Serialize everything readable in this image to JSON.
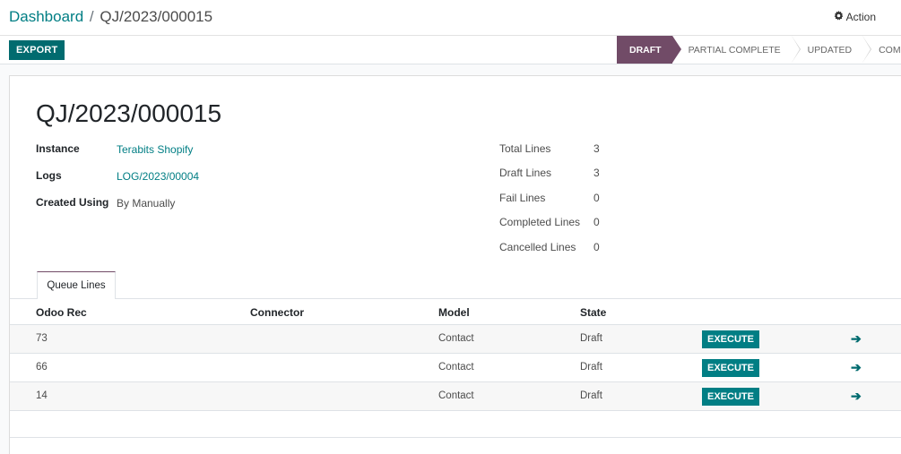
{
  "breadcrumb": {
    "parent": "Dashboard",
    "separator": "/",
    "current": "QJ/2023/000015"
  },
  "action": {
    "icon": "gear-icon",
    "label": "Action"
  },
  "toolbar": {
    "export_label": "EXPORT"
  },
  "statusbar": {
    "stages": [
      {
        "label": "DRAFT",
        "active": true
      },
      {
        "label": "PARTIAL COMPLETE",
        "active": false
      },
      {
        "label": "UPDATED",
        "active": false
      },
      {
        "label": "COMPLETE",
        "active": false
      }
    ]
  },
  "record": {
    "title": "QJ/2023/000015",
    "fields": {
      "instance": {
        "label": "Instance",
        "value": "Terabits Shopify"
      },
      "logs": {
        "label": "Logs",
        "value": "LOG/2023/00004"
      },
      "created_using": {
        "label": "Created Using",
        "value": "By Manually"
      }
    },
    "stats": [
      {
        "label": "Total Lines",
        "value": "3"
      },
      {
        "label": "Draft Lines",
        "value": "3"
      },
      {
        "label": "Fail Lines",
        "value": "0"
      },
      {
        "label": "Completed Lines",
        "value": "0"
      },
      {
        "label": "Cancelled Lines",
        "value": "0"
      }
    ]
  },
  "tabs": [
    {
      "label": "Queue Lines"
    }
  ],
  "table": {
    "headers": [
      "Odoo Rec",
      "Connector",
      "Model",
      "State"
    ],
    "execute_label": "EXECUTE",
    "rows": [
      {
        "odoo_rec": "73",
        "connector": "",
        "model": "Contact",
        "state": "Draft"
      },
      {
        "odoo_rec": "66",
        "connector": "",
        "model": "Contact",
        "state": "Draft"
      },
      {
        "odoo_rec": "14",
        "connector": "",
        "model": "Contact",
        "state": "Draft"
      }
    ]
  },
  "colors": {
    "primary": "#714b67",
    "accent": "#017e84"
  }
}
